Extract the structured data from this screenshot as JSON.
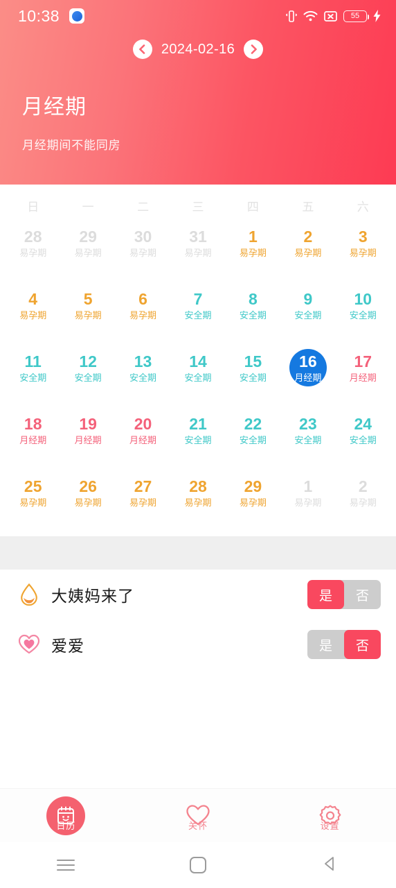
{
  "statusbar": {
    "time": "10:38",
    "app_icon": "app-icon",
    "icons": [
      "vibrate-icon",
      "wifi-icon",
      "no-sim-icon",
      "battery-icon",
      "charging-bolt-icon"
    ],
    "battery_level": "55"
  },
  "datenav": {
    "prev_icon": "chevron-left-icon",
    "next_icon": "chevron-right-icon",
    "date": "2024-02-16"
  },
  "header": {
    "title": "月经期",
    "subtitle": "月经期间不能同房",
    "gradient_from": "#FB8D87",
    "gradient_to": "#FD3B53"
  },
  "calendar": {
    "weekdays": [
      "日",
      "一",
      "二",
      "三",
      "四",
      "五",
      "六"
    ],
    "colors": {
      "fertile": "#EFA430",
      "safe": "#3FC8C8",
      "period": "#F4617A",
      "outside": "#DCDCDC",
      "selected_bg": "#1579E0"
    },
    "labels": {
      "fertile": "易孕期",
      "safe": "安全期",
      "period": "月经期"
    },
    "days": [
      {
        "num": "28",
        "label": "易孕期",
        "type": "out",
        "selected": false
      },
      {
        "num": "29",
        "label": "易孕期",
        "type": "out",
        "selected": false
      },
      {
        "num": "30",
        "label": "易孕期",
        "type": "out",
        "selected": false
      },
      {
        "num": "31",
        "label": "易孕期",
        "type": "out",
        "selected": false
      },
      {
        "num": "1",
        "label": "易孕期",
        "type": "fertile",
        "selected": false
      },
      {
        "num": "2",
        "label": "易孕期",
        "type": "fertile",
        "selected": false
      },
      {
        "num": "3",
        "label": "易孕期",
        "type": "fertile",
        "selected": false
      },
      {
        "num": "4",
        "label": "易孕期",
        "type": "fertile",
        "selected": false
      },
      {
        "num": "5",
        "label": "易孕期",
        "type": "fertile",
        "selected": false
      },
      {
        "num": "6",
        "label": "易孕期",
        "type": "fertile",
        "selected": false
      },
      {
        "num": "7",
        "label": "安全期",
        "type": "safe",
        "selected": false
      },
      {
        "num": "8",
        "label": "安全期",
        "type": "safe",
        "selected": false
      },
      {
        "num": "9",
        "label": "安全期",
        "type": "safe",
        "selected": false
      },
      {
        "num": "10",
        "label": "安全期",
        "type": "safe",
        "selected": false
      },
      {
        "num": "11",
        "label": "安全期",
        "type": "safe",
        "selected": false
      },
      {
        "num": "12",
        "label": "安全期",
        "type": "safe",
        "selected": false
      },
      {
        "num": "13",
        "label": "安全期",
        "type": "safe",
        "selected": false
      },
      {
        "num": "14",
        "label": "安全期",
        "type": "safe",
        "selected": false
      },
      {
        "num": "15",
        "label": "安全期",
        "type": "safe",
        "selected": false
      },
      {
        "num": "16",
        "label": "月经期",
        "type": "period",
        "selected": true
      },
      {
        "num": "17",
        "label": "月经期",
        "type": "period",
        "selected": false
      },
      {
        "num": "18",
        "label": "月经期",
        "type": "period",
        "selected": false
      },
      {
        "num": "19",
        "label": "月经期",
        "type": "period",
        "selected": false
      },
      {
        "num": "20",
        "label": "月经期",
        "type": "period",
        "selected": false
      },
      {
        "num": "21",
        "label": "安全期",
        "type": "safe",
        "selected": false
      },
      {
        "num": "22",
        "label": "安全期",
        "type": "safe",
        "selected": false
      },
      {
        "num": "23",
        "label": "安全期",
        "type": "safe",
        "selected": false
      },
      {
        "num": "24",
        "label": "安全期",
        "type": "safe",
        "selected": false
      },
      {
        "num": "25",
        "label": "易孕期",
        "type": "fertile",
        "selected": false
      },
      {
        "num": "26",
        "label": "易孕期",
        "type": "fertile",
        "selected": false
      },
      {
        "num": "27",
        "label": "易孕期",
        "type": "fertile",
        "selected": false
      },
      {
        "num": "28",
        "label": "易孕期",
        "type": "fertile",
        "selected": false
      },
      {
        "num": "29",
        "label": "易孕期",
        "type": "fertile",
        "selected": false
      },
      {
        "num": "1",
        "label": "易孕期",
        "type": "out",
        "selected": false
      },
      {
        "num": "2",
        "label": "易孕期",
        "type": "out",
        "selected": false
      }
    ]
  },
  "list": {
    "rows": [
      {
        "icon": "blood-drop-icon",
        "label": "大姨妈来了",
        "yes": "是",
        "no": "否",
        "selected": "yes"
      },
      {
        "icon": "heart-icon",
        "label": "爱爱",
        "yes": "是",
        "no": "否",
        "selected": "no"
      }
    ],
    "active_color": "#F9485F",
    "inactive_color": "#CDCDCD"
  },
  "tabbar": {
    "tabs": [
      {
        "icon": "calendar-icon",
        "label": "日历",
        "active": true
      },
      {
        "icon": "heart-outline-icon",
        "label": "关怀",
        "active": false
      },
      {
        "icon": "gear-icon",
        "label": "设置",
        "active": false
      }
    ],
    "active_color": "#F4616F",
    "inactive_color": "#F4838E"
  },
  "androidnav": {
    "recent": "recents-icon",
    "home": "home-icon",
    "back": "back-icon"
  }
}
